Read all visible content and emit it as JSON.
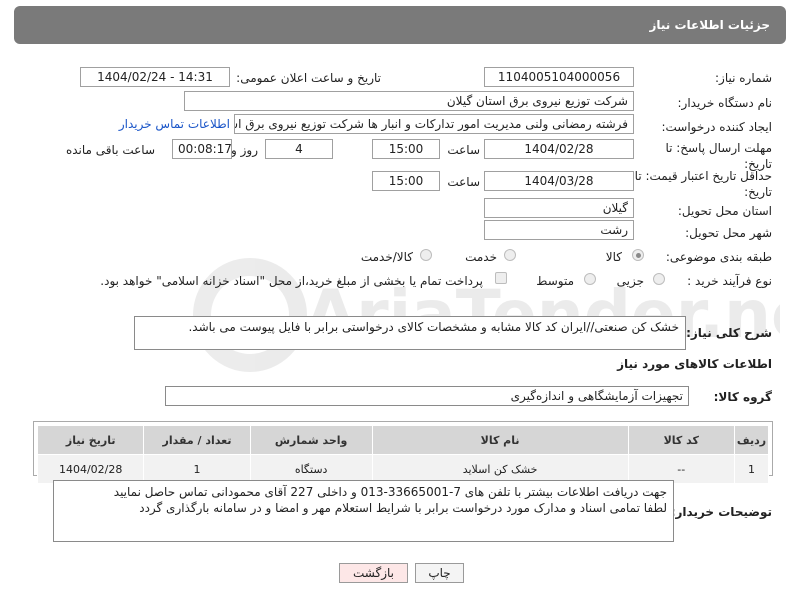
{
  "header": {
    "title": "جزئیات اطلاعات نیاز"
  },
  "labels": {
    "need_number": "شماره نیاز:",
    "announce_datetime": "تاریخ و ساعت اعلان عمومی:",
    "buyer_org": "نام دستگاه خریدار:",
    "requester": "ایجاد کننده درخواست:",
    "reply_deadline": "مهلت ارسال پاسخ: تا تاریخ:",
    "price_validity": "حداقل تاریخ اعتبار قیمت: تا تاریخ:",
    "time": "ساعت",
    "day_and": "روز و",
    "remaining": "ساعت باقی مانده",
    "province": "استان محل تحویل:",
    "city": "شهر محل تحویل:",
    "category": "طبقه بندی موضوعی:",
    "purchase_type": "نوع فرآیند خرید :",
    "description": "شرح کلی نیاز:",
    "goods_info": "اطلاعات کالاهای مورد نیاز",
    "goods_group": "گروه کالا:",
    "buyer_notes": "توضیحات خریدار:"
  },
  "fields": {
    "need_number": "1104005104000056",
    "announce_datetime": "1404/02/24 - 14:31",
    "buyer_org": "شرکت توزیع نیروی برق استان گیلان",
    "requester": "فرشته رمضانی ولنی مدیریت امور تدارکات و انبار ها شرکت توزیع نیروی برق استان گیلان",
    "contact_link": "اطلاعات تماس خریدار",
    "reply_date": "1404/02/28",
    "reply_time": "15:00",
    "days": "4",
    "remaining_time": "00:08:17",
    "validity_date": "1404/03/28",
    "validity_time": "15:00",
    "province": "گیلان",
    "city": "رشت",
    "description": "خشک کن صنعتی//ایران کد کالا مشابه و مشخصات کالای درخواستی برابر با فایل پیوست می باشد.",
    "goods_group": "تجهیزات آزمایشگاهی و اندازه‌گیری",
    "buyer_notes_line1": "جهت دریافت اطلاعات بیشتر با تلفن های 7-33665001-013 و داخلی 227 آقای محمودانی تماس حاصل نمایید",
    "buyer_notes_line2": "لطفا تمامی اسناد و مدارک مورد درخواست برابر با شرایط استعلام مهر و امضا و در سامانه بارگذاری گردد"
  },
  "category_options": [
    {
      "label": "کالا",
      "selected": true
    },
    {
      "label": "خدمت",
      "selected": false
    },
    {
      "label": "کالا/خدمت",
      "selected": false
    }
  ],
  "purchase_options": [
    {
      "label": "جزیی",
      "selected": false
    },
    {
      "label": "متوسط",
      "selected": false
    }
  ],
  "payment_note": "پرداخت تمام یا بخشی از مبلغ خرید،از محل \"اسناد خزانه اسلامی\" خواهد بود.",
  "table": {
    "headers": [
      "ردیف",
      "کد کالا",
      "نام کالا",
      "واحد شمارش",
      "تعداد / مقدار",
      "تاریخ نیاز"
    ],
    "rows": [
      [
        "1",
        "--",
        "خشک کن اسلاید",
        "دستگاه",
        "1",
        "1404/02/28"
      ]
    ]
  },
  "buttons": {
    "print": "چاپ",
    "back": "بازگشت"
  },
  "watermark": {
    "text": "AriaTender.neT"
  }
}
